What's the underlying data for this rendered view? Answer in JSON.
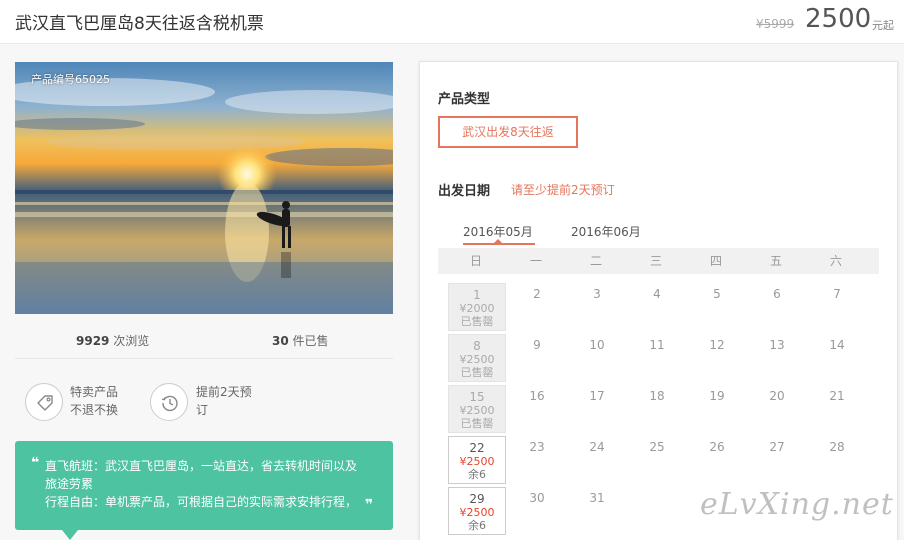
{
  "header": {
    "title": "武汉直飞巴厘岛8天往返含税机票",
    "old_price": "¥5999",
    "price": "2500",
    "price_unit": "元起"
  },
  "photo": {
    "product_no": "产品编号65025"
  },
  "stats": {
    "views_count": "9929",
    "views_label": "次浏览",
    "sold_count": "30",
    "sold_label": "件已售"
  },
  "features": [
    {
      "icon": "tag-icon",
      "line1": "特卖产品",
      "line2": "不退不换"
    },
    {
      "icon": "clock-icon",
      "line1": "提前2天预",
      "line2": "订"
    }
  ],
  "promo": {
    "line1": "直飞航班：武汉直飞巴厘岛，一站直达，省去转机时间以及",
    "line2": "旅途劳累",
    "line3": "行程自由：单机票产品，可根据自己的实际需求安排行程，",
    "open_quote": "❝",
    "close_quote": "❞"
  },
  "booking": {
    "type_label": "产品类型",
    "type_option": "武汉出发8天往返",
    "date_label": "出发日期",
    "date_hint": "请至少提前2天预订",
    "month_tabs": [
      "2016年05月",
      "2016年06月"
    ],
    "weekdays": [
      "日",
      "一",
      "二",
      "三",
      "四",
      "五",
      "六"
    ],
    "days": [
      {
        "d": "1",
        "price": "¥2000",
        "status": "已售罄",
        "state": "soldout"
      },
      {
        "d": "2",
        "state": "plain"
      },
      {
        "d": "3",
        "state": "plain"
      },
      {
        "d": "4",
        "state": "plain"
      },
      {
        "d": "5",
        "state": "plain"
      },
      {
        "d": "6",
        "state": "plain"
      },
      {
        "d": "7",
        "state": "plain"
      },
      {
        "d": "8",
        "price": "¥2500",
        "status": "已售罄",
        "state": "soldout"
      },
      {
        "d": "9",
        "state": "plain"
      },
      {
        "d": "10",
        "state": "plain"
      },
      {
        "d": "11",
        "state": "plain"
      },
      {
        "d": "12",
        "state": "plain"
      },
      {
        "d": "13",
        "state": "plain"
      },
      {
        "d": "14",
        "state": "plain"
      },
      {
        "d": "15",
        "price": "¥2500",
        "status": "已售罄",
        "state": "soldout"
      },
      {
        "d": "16",
        "state": "plain"
      },
      {
        "d": "17",
        "state": "plain"
      },
      {
        "d": "18",
        "state": "plain"
      },
      {
        "d": "19",
        "state": "plain"
      },
      {
        "d": "20",
        "state": "plain"
      },
      {
        "d": "21",
        "state": "plain"
      },
      {
        "d": "22",
        "price": "¥2500",
        "status": "余6",
        "state": "avail"
      },
      {
        "d": "23",
        "state": "plain"
      },
      {
        "d": "24",
        "state": "plain"
      },
      {
        "d": "25",
        "state": "plain"
      },
      {
        "d": "26",
        "state": "plain"
      },
      {
        "d": "27",
        "state": "plain"
      },
      {
        "d": "28",
        "state": "plain"
      },
      {
        "d": "29",
        "price": "¥2500",
        "status": "余6",
        "state": "avail"
      },
      {
        "d": "30",
        "state": "plain"
      },
      {
        "d": "31",
        "state": "plain"
      }
    ]
  },
  "watermark": "eLvXing.net",
  "colors": {
    "accent": "#e4765b",
    "promo_bg": "#4ec3a2",
    "available_price": "#e8452d"
  }
}
